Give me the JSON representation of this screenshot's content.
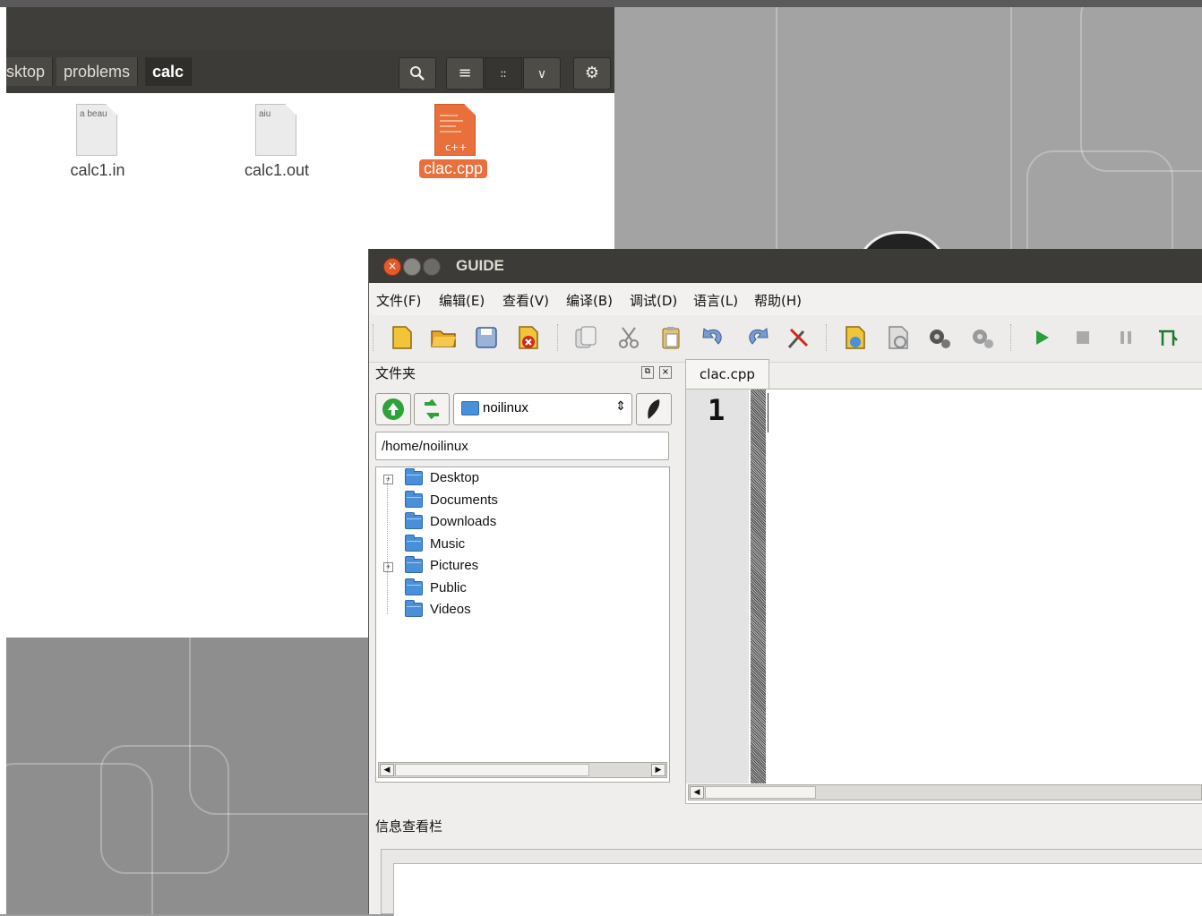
{
  "file_manager": {
    "breadcrumbs": [
      "sktop",
      "problems",
      "calc"
    ],
    "view_buttons": [
      "search-icon",
      "list-view-icon",
      "grid-view-icon",
      "chevron-down-icon",
      "gear-icon"
    ],
    "files": [
      {
        "name": "calc1.in",
        "preview": "a beau",
        "type": "text"
      },
      {
        "name": "calc1.out",
        "preview": "aiu",
        "type": "text"
      },
      {
        "name": "clac.cpp",
        "preview": "c++",
        "type": "cpp",
        "selected": true
      }
    ]
  },
  "guide": {
    "title": "GUIDE",
    "menu": [
      "文件(F)",
      "编辑(E)",
      "查看(V)",
      "编译(B)",
      "调试(D)",
      "语言(L)",
      "帮助(H)"
    ],
    "file_panel": {
      "title": "文件夹",
      "location_combo": "noilinux",
      "path": "/home/noilinux",
      "folders": [
        {
          "name": "Desktop",
          "expandable": true
        },
        {
          "name": "Documents",
          "expandable": false
        },
        {
          "name": "Downloads",
          "expandable": false
        },
        {
          "name": "Music",
          "expandable": false
        },
        {
          "name": "Pictures",
          "expandable": true
        },
        {
          "name": "Public",
          "expandable": false
        },
        {
          "name": "Videos",
          "expandable": false
        }
      ]
    },
    "editor": {
      "tab": "clac.cpp",
      "line_numbers": [
        "1"
      ]
    },
    "info_panel": {
      "title": "信息查看栏"
    },
    "colors": {
      "selection": "#e9703c",
      "titlebar": "#3c3b37",
      "close_button": "#e25b2c"
    }
  }
}
